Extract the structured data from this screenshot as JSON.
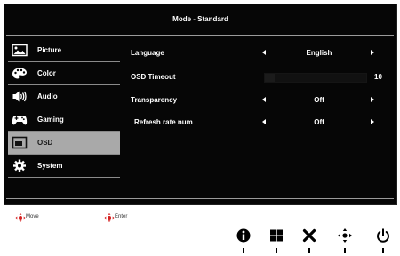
{
  "header": {
    "title": "Mode - Standard"
  },
  "sidebar": {
    "items": [
      {
        "label": "Picture",
        "icon": "picture-icon"
      },
      {
        "label": "Color",
        "icon": "color-palette-icon"
      },
      {
        "label": "Audio",
        "icon": "speaker-icon"
      },
      {
        "label": "Gaming",
        "icon": "gamepad-icon"
      },
      {
        "label": "OSD",
        "icon": "osd-icon",
        "selected": true
      },
      {
        "label": "System",
        "icon": "gear-icon"
      }
    ]
  },
  "settings": {
    "language": {
      "label": "Language",
      "value": "English"
    },
    "osd_timeout": {
      "label": "OSD Timeout",
      "value": "10",
      "level": 0.1
    },
    "transparency": {
      "label": "Transparency",
      "value": "Off"
    },
    "refresh_rate_num": {
      "label": "Refresh rate num",
      "value": "Off"
    }
  },
  "hints": {
    "move": {
      "label": "Move",
      "icon": "dpad-move-icon"
    },
    "enter": {
      "label": "Enter",
      "icon": "dpad-enter-icon"
    }
  },
  "buttons": [
    {
      "icon": "info-icon"
    },
    {
      "icon": "grid-icon"
    },
    {
      "icon": "close-icon"
    },
    {
      "icon": "navigate-icon"
    },
    {
      "icon": "power-icon"
    }
  ],
  "colors": {
    "background": "#060606",
    "selected": "#a9a9a9",
    "hint_accent": "#d42020"
  }
}
